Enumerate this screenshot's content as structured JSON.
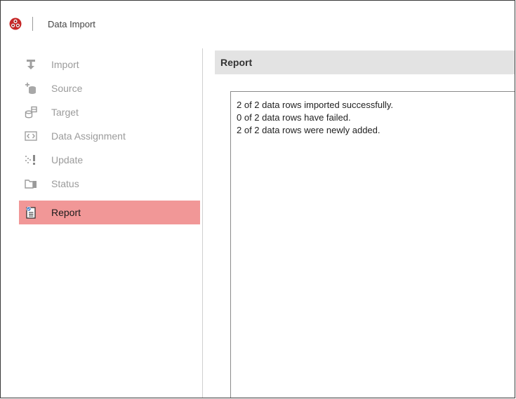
{
  "window": {
    "title": "Data Import",
    "logo_icon": "tri-circle-logo-icon"
  },
  "sidebar": {
    "items": [
      {
        "label": "Import",
        "icon": "import-icon",
        "active": false
      },
      {
        "label": "Source",
        "icon": "source-database-icon",
        "active": false
      },
      {
        "label": "Target",
        "icon": "target-database-icon",
        "active": false
      },
      {
        "label": "Data Assignment",
        "icon": "data-assignment-icon",
        "active": false
      },
      {
        "label": "Update",
        "icon": "update-icon",
        "active": false
      },
      {
        "label": "Status",
        "icon": "status-icon",
        "active": false
      },
      {
        "label": "Report",
        "icon": "report-icon",
        "active": true
      }
    ]
  },
  "main": {
    "header": "Report",
    "report_lines": [
      "2 of 2 data rows imported successfully.",
      "0 of 2 data rows have failed.",
      "2 of 2 data rows were newly added."
    ]
  },
  "colors": {
    "active_item_bg": "#f19797",
    "header_bg": "#e3e3e3",
    "logo_red": "#c0392b"
  }
}
